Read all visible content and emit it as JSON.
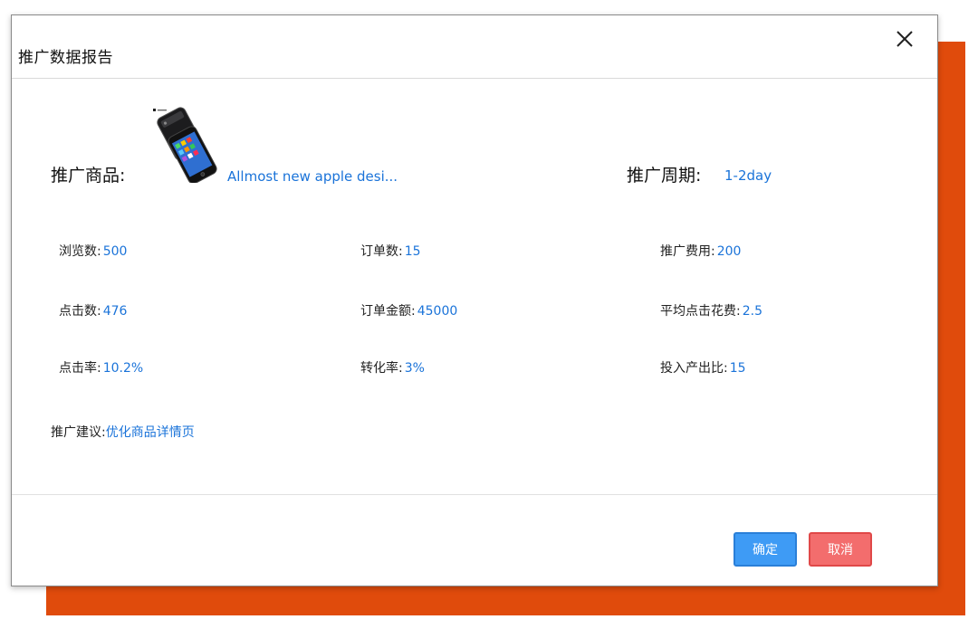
{
  "dialog": {
    "title": "推广数据报告",
    "close_icon": "close-icon"
  },
  "product": {
    "label": "推广商品:",
    "name": "Allmost new apple desi...",
    "image": "smartphone-image"
  },
  "period": {
    "label": "推广周期:",
    "value": "1-2day"
  },
  "stats": {
    "views": {
      "label": "浏览数:",
      "value": "500"
    },
    "orders": {
      "label": "订单数:",
      "value": "15"
    },
    "cost": {
      "label": "推广费用:",
      "value": "200"
    },
    "clicks": {
      "label": "点击数:",
      "value": "476"
    },
    "order_amount": {
      "label": "订单金额:",
      "value": "45000"
    },
    "avg_click_cost": {
      "label": "平均点击花费:",
      "value": "2.5"
    },
    "click_rate": {
      "label": "点击率:",
      "value": "10.2%"
    },
    "conversion_rate": {
      "label": "转化率:",
      "value": "3%"
    },
    "roi": {
      "label": "投入产出比:",
      "value": "15"
    }
  },
  "suggestion": {
    "label": "推广建议:",
    "value": "优化商品详情页"
  },
  "buttons": {
    "confirm": "确定",
    "cancel": "取消"
  },
  "colors": {
    "accent_blue": "#1a73d9",
    "confirm_button": "#3e9bf5",
    "cancel_button": "#f36d6d",
    "backdrop_orange": "#e04b0c"
  }
}
